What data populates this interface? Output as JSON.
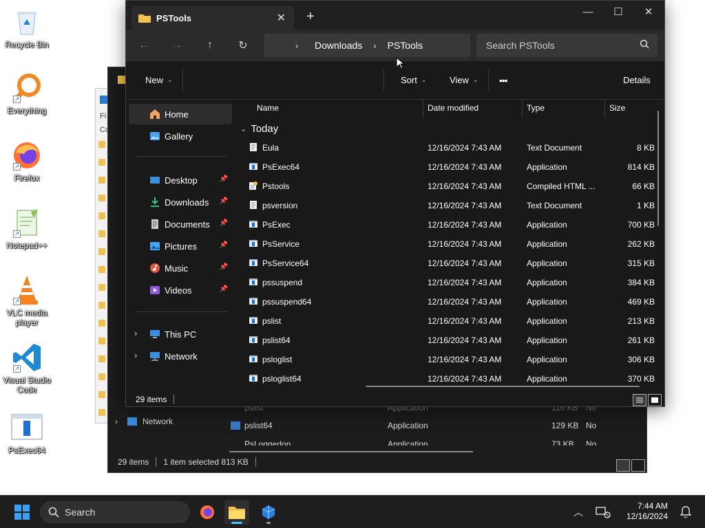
{
  "desktop": {
    "icons": [
      {
        "label": "Recycle Bin",
        "icon": "recycle-bin-icon"
      },
      {
        "label": "Everything",
        "icon": "everything-search-icon"
      },
      {
        "label": "Firefox",
        "icon": "firefox-icon"
      },
      {
        "label": "Notepad++",
        "icon": "notepad-plus-plus-icon"
      },
      {
        "label": "VLC media player",
        "icon": "vlc-icon"
      },
      {
        "label": "Visual Studio Code",
        "icon": "vscode-icon"
      },
      {
        "label": "PsExec64",
        "icon": "app-exe-icon"
      }
    ]
  },
  "background_window": {
    "sidebar_network": "Network",
    "rows": [
      {
        "name": "pslist",
        "type": "Application",
        "size": "116 KB",
        "extra": "No"
      },
      {
        "name": "pslist64",
        "type": "Application",
        "size": "129 KB",
        "extra": "No"
      },
      {
        "name": "PsLoggedon",
        "type": "Application",
        "size": "73 KB",
        "extra": "No"
      }
    ],
    "status": {
      "items": "29 items",
      "selected": "1 item selected  813 KB"
    }
  },
  "window": {
    "tab_title": "PSTools",
    "breadcrumb": [
      "Downloads",
      "PSTools"
    ],
    "search_placeholder": "Search PSTools",
    "toolbar": {
      "new": "New",
      "sort": "Sort",
      "view": "View",
      "more": "•••",
      "details": "Details"
    },
    "nav": {
      "home": "Home",
      "gallery": "Gallery",
      "desktop": "Desktop",
      "downloads": "Downloads",
      "documents": "Documents",
      "pictures": "Pictures",
      "music": "Music",
      "videos": "Videos",
      "this_pc": "This PC",
      "network": "Network"
    },
    "columns": {
      "name": "Name",
      "date": "Date modified",
      "type": "Type",
      "size": "Size"
    },
    "group_label": "Today",
    "files": [
      {
        "name": "Eula",
        "date": "12/16/2024 7:43 AM",
        "type": "Text Document",
        "size": "8 KB",
        "icon": "text-file-icon"
      },
      {
        "name": "PsExec64",
        "date": "12/16/2024 7:43 AM",
        "type": "Application",
        "size": "814 KB",
        "icon": "app-exe-icon"
      },
      {
        "name": "Pstools",
        "date": "12/16/2024 7:43 AM",
        "type": "Compiled HTML ...",
        "size": "66 KB",
        "icon": "chm-file-icon"
      },
      {
        "name": "psversion",
        "date": "12/16/2024 7:43 AM",
        "type": "Text Document",
        "size": "1 KB",
        "icon": "text-file-icon"
      },
      {
        "name": "PsExec",
        "date": "12/16/2024 7:43 AM",
        "type": "Application",
        "size": "700 KB",
        "icon": "app-exe-icon"
      },
      {
        "name": "PsService",
        "date": "12/16/2024 7:43 AM",
        "type": "Application",
        "size": "262 KB",
        "icon": "app-exe-icon"
      },
      {
        "name": "PsService64",
        "date": "12/16/2024 7:43 AM",
        "type": "Application",
        "size": "315 KB",
        "icon": "app-exe-icon"
      },
      {
        "name": "pssuspend",
        "date": "12/16/2024 7:43 AM",
        "type": "Application",
        "size": "384 KB",
        "icon": "app-exe-icon"
      },
      {
        "name": "pssuspend64",
        "date": "12/16/2024 7:43 AM",
        "type": "Application",
        "size": "469 KB",
        "icon": "app-exe-icon"
      },
      {
        "name": "pslist",
        "date": "12/16/2024 7:43 AM",
        "type": "Application",
        "size": "213 KB",
        "icon": "app-exe-icon"
      },
      {
        "name": "pslist64",
        "date": "12/16/2024 7:43 AM",
        "type": "Application",
        "size": "261 KB",
        "icon": "app-exe-icon"
      },
      {
        "name": "psloglist",
        "date": "12/16/2024 7:43 AM",
        "type": "Application",
        "size": "306 KB",
        "icon": "app-exe-icon"
      },
      {
        "name": "psloglist64",
        "date": "12/16/2024 7:43 AM",
        "type": "Application",
        "size": "370 KB",
        "icon": "app-exe-icon"
      }
    ],
    "status": {
      "items": "29 items"
    }
  },
  "taskbar": {
    "search_label": "Search",
    "time": "7:44 AM",
    "date": "12/16/2024"
  },
  "colors": {
    "accent": "#4cc2ff",
    "folder_yellow": "#f2c14e",
    "window_bg": "#191919",
    "taskbar_bg": "#1e1e1e"
  }
}
